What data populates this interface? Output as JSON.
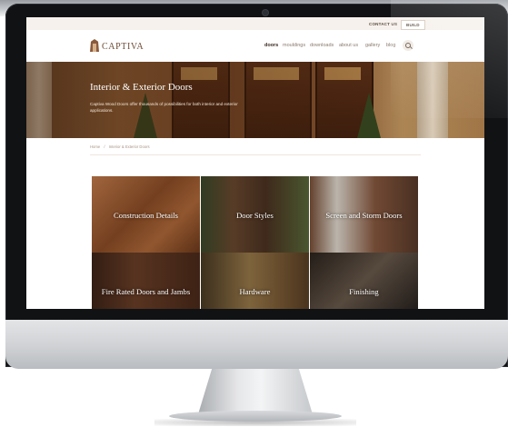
{
  "utility": {
    "contact_label": "CONTACT US",
    "build_label": "BUILD"
  },
  "brand": {
    "name": "CAPTIVA"
  },
  "nav": {
    "items": [
      {
        "label": "doors",
        "active": true
      },
      {
        "label": "mouldings",
        "active": false
      },
      {
        "label": "downloads",
        "active": false
      },
      {
        "label": "about us",
        "active": false
      },
      {
        "label": "gallery",
        "active": false
      },
      {
        "label": "blog",
        "active": false
      }
    ],
    "search_icon": "search-icon"
  },
  "hero": {
    "title": "Interior & Exterior Doors",
    "subtitle": "Captiva Wood Doors offer thousands of possibilities for both interior and exterior applications."
  },
  "breadcrumb": {
    "home": "Home",
    "separator": "/",
    "current": "Interior & Exterior Doors"
  },
  "categories": [
    {
      "label": "Construction Details"
    },
    {
      "label": "Door Styles"
    },
    {
      "label": "Screen and Storm Doors"
    },
    {
      "label": "Fire Rated Doors and Jambs"
    },
    {
      "label": "Hardware"
    },
    {
      "label": "Finishing"
    }
  ],
  "colors": {
    "monitor_bezel": "#111214",
    "accent_brown": "#6d4a34",
    "utility_bar": "#f6f1ec"
  }
}
